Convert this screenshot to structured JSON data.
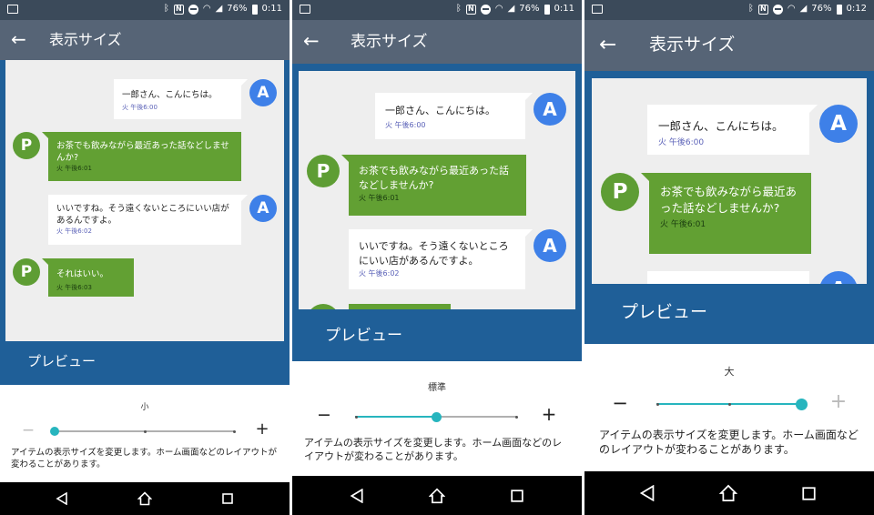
{
  "screens": [
    {
      "status": {
        "battery": "76%",
        "time": "0:11"
      },
      "appbar": {
        "title": "表示サイズ"
      },
      "preview_label": "プレビュー",
      "messages": [
        {
          "from": "A",
          "text": "一郎さん、こんにちは。",
          "time": "火 午後6:00"
        },
        {
          "from": "P",
          "text": "お茶でも飲みながら最近あった話などしませんか?",
          "time": "火 午後6:01"
        },
        {
          "from": "A",
          "text": "いいですね。そう遠くないところにいい店があるんですよ。",
          "time": "火 午後6:02"
        },
        {
          "from": "P",
          "text": "それはいい。",
          "time": "火 午後6:03"
        }
      ],
      "size_label": "小",
      "slider": {
        "steps": 3,
        "selected_index": 0
      },
      "minus": "−",
      "plus": "+",
      "description": "アイテムの表示サイズを変更します。ホーム画面などのレイアウトが変わることがあります。"
    },
    {
      "status": {
        "battery": "76%",
        "time": "0:11"
      },
      "appbar": {
        "title": "表示サイズ"
      },
      "preview_label": "プレビュー",
      "messages": [
        {
          "from": "A",
          "text": "一郎さん、こんにちは。",
          "time": "火 午後6:00"
        },
        {
          "from": "P",
          "text": "お茶でも飲みながら最近あった話などしませんか?",
          "time": "火 午後6:01"
        },
        {
          "from": "A",
          "text": "いいですね。そう遠くないところにいい店があるんですよ。",
          "time": "火 午後6:02"
        }
      ],
      "size_label": "標準",
      "slider": {
        "steps": 3,
        "selected_index": 1
      },
      "minus": "−",
      "plus": "+",
      "description": "アイテムの表示サイズを変更します。ホーム画面などのレイアウトが変わることがあります。"
    },
    {
      "status": {
        "battery": "76%",
        "time": "0:12"
      },
      "appbar": {
        "title": "表示サイズ"
      },
      "preview_label": "プレビュー",
      "messages": [
        {
          "from": "A",
          "text": "一郎さん、こんにちは。",
          "time": "火 午後6:00"
        },
        {
          "from": "P",
          "text": "お茶でも飲みながら最近あった話などしませんか?",
          "time": "火 午後6:01"
        },
        {
          "from": "A",
          "text": "",
          "time": ""
        }
      ],
      "size_label": "大",
      "slider": {
        "steps": 3,
        "selected_index": 2
      },
      "minus": "−",
      "plus": "+",
      "description": "アイテムの表示サイズを変更します。ホーム画面などのレイアウトが変わることがあります。"
    }
  ],
  "colors": {
    "statusbar": "#3b4a5a",
    "appbar": "#566476",
    "preview_bg": "#1f5f98",
    "avatar_a": "#3e80e8",
    "avatar_p": "#5e9d34",
    "bubble_green": "#62a033",
    "slider_accent": "#27b5be"
  },
  "icons": {
    "status": [
      "gallery-icon",
      "bluetooth-icon",
      "nfc-icon",
      "do-not-disturb-icon",
      "wifi-icon",
      "signal-icon",
      "battery-icon"
    ],
    "appbar": "back-arrow-icon",
    "navbar": [
      "nav-back-icon",
      "nav-home-icon",
      "nav-recents-icon"
    ]
  }
}
